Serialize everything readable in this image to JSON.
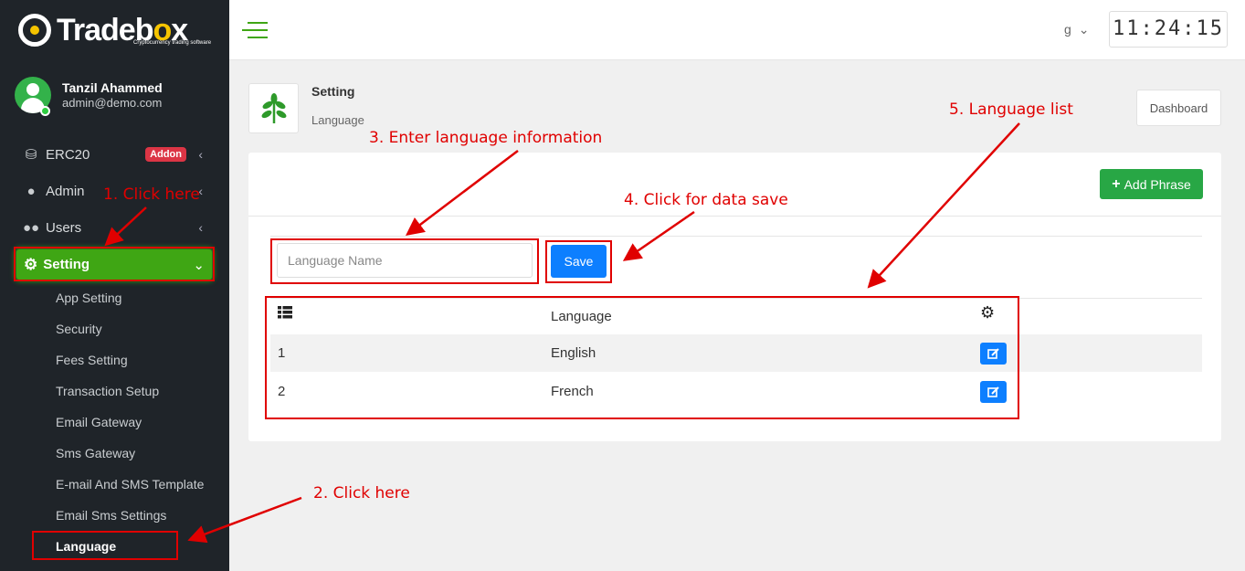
{
  "brand": {
    "name_part1": "Trade",
    "name_part2": "b",
    "name_part3": "x",
    "name_o": "o",
    "tagline": "Cryptocurrency trading software"
  },
  "profile": {
    "name": "Tanzil Ahammed",
    "email": "admin@demo.com"
  },
  "sidebar": {
    "items": [
      {
        "label": "ERC20",
        "badge": "Addon"
      },
      {
        "label": "Admin"
      },
      {
        "label": "Users"
      },
      {
        "label": "Setting"
      }
    ],
    "sub_items": [
      "App Setting",
      "Security",
      "Fees Setting",
      "Transaction Setup",
      "Email Gateway",
      "Sms Gateway",
      "E-mail And SMS Template",
      "Email Sms Settings",
      "Language"
    ]
  },
  "topbar": {
    "lang_value": "g",
    "clock": "11:24:15"
  },
  "breadcrumb": {
    "title": "Setting",
    "subtitle": "Language",
    "dashboard_label": "Dashboard"
  },
  "card": {
    "add_phrase_label": "Add Phrase",
    "input_placeholder": "Language Name",
    "save_label": "Save",
    "table": {
      "header_language": "Language",
      "rows": [
        {
          "id": "1",
          "language": "English"
        },
        {
          "id": "2",
          "language": "French"
        }
      ]
    }
  },
  "annotations": {
    "a1": "1. Click here",
    "a2": "2. Click here",
    "a3": "3. Enter language information",
    "a4": "4. Click for data save",
    "a5": "5. Language list"
  },
  "colors": {
    "sidebar_bg": "#1f2429",
    "active_green": "#3fa614",
    "primary_blue": "#0d7fff",
    "annotation_red": "#e00000",
    "badge_red": "#dc3545"
  }
}
